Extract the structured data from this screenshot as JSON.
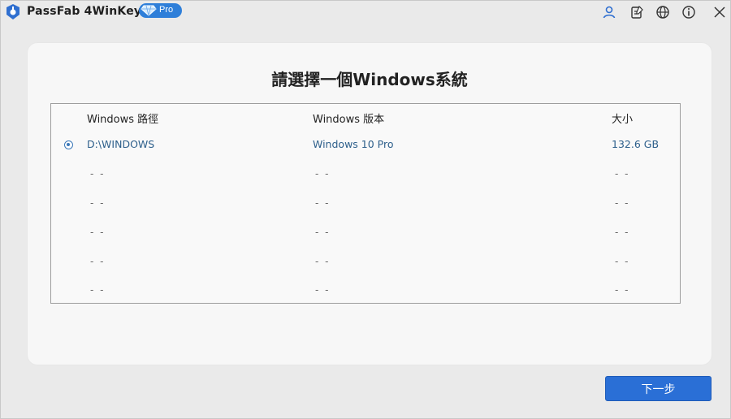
{
  "titlebar": {
    "app_name": "PassFab 4WinKey",
    "badge": "Pro",
    "icons": [
      "user-icon",
      "feedback-icon",
      "language-icon",
      "info-icon",
      "close-icon"
    ]
  },
  "panel": {
    "title": "請選擇一個Windows系統"
  },
  "table": {
    "headers": {
      "path": "Windows 路徑",
      "version": "Windows 版本",
      "size": "大小"
    },
    "rows": [
      {
        "path": "D:\\WINDOWS",
        "version": "Windows 10 Pro",
        "size": "132.6 GB",
        "selected": true
      },
      {
        "path": "- -",
        "version": "- -",
        "size": "- -"
      },
      {
        "path": "- -",
        "version": "- -",
        "size": "- -"
      },
      {
        "path": "- -",
        "version": "- -",
        "size": "- -"
      },
      {
        "path": "- -",
        "version": "- -",
        "size": "- -"
      },
      {
        "path": "- -",
        "version": "- -",
        "size": "- -"
      }
    ]
  },
  "footer": {
    "next_label": "下一步"
  },
  "colors": {
    "accent": "#2a6fd6",
    "row_text": "#2d5f8b"
  }
}
